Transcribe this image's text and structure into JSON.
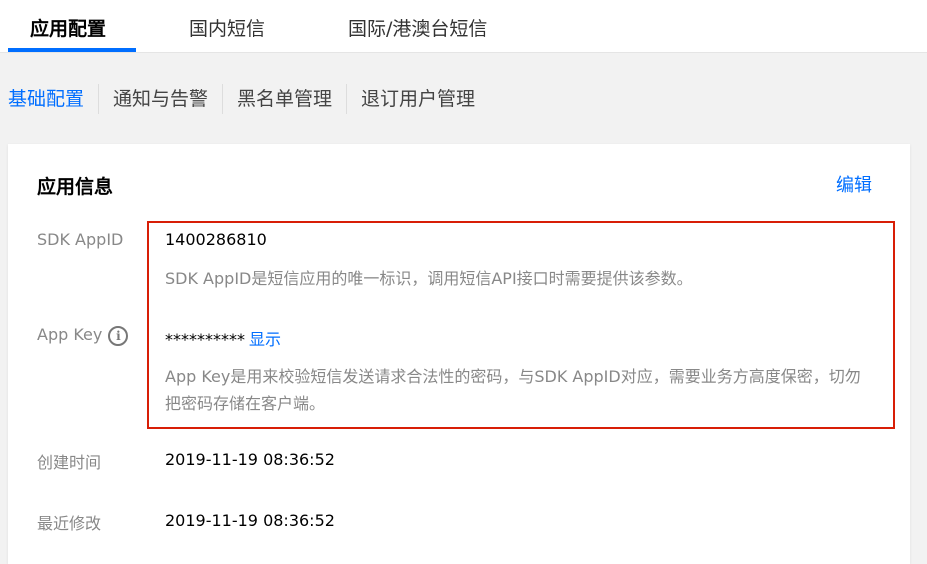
{
  "top_tabs": [
    {
      "label": "应用配置",
      "active": true
    },
    {
      "label": "国内短信",
      "active": false
    },
    {
      "label": "国际/港澳台短信",
      "active": false
    }
  ],
  "sub_nav": [
    {
      "label": "基础配置",
      "active": true
    },
    {
      "label": "通知与告警",
      "active": false
    },
    {
      "label": "黑名单管理",
      "active": false
    },
    {
      "label": "退订用户管理",
      "active": false
    }
  ],
  "card": {
    "title": "应用信息",
    "edit_label": "编辑",
    "sdk_appid": {
      "label": "SDK AppID",
      "value": "1400286810",
      "description": "SDK AppID是短信应用的唯一标识，调用短信API接口时需要提供该参数。"
    },
    "app_key": {
      "label": "App Key",
      "masked_value": "**********",
      "show_label": "显示",
      "description": "App Key是用来校验短信发送请求合法性的密码，与SDK AppID对应，需要业务方高度保密，切勿把密码存储在客户端。"
    },
    "created": {
      "label": "创建时间",
      "value": "2019-11-19 08:36:52"
    },
    "modified": {
      "label": "最近修改",
      "value": "2019-11-19 08:36:52"
    }
  },
  "colors": {
    "accent": "#006eff",
    "highlight_border": "#d81e06",
    "muted_text": "#888888"
  },
  "icons": {
    "info": "info-circle-icon"
  }
}
